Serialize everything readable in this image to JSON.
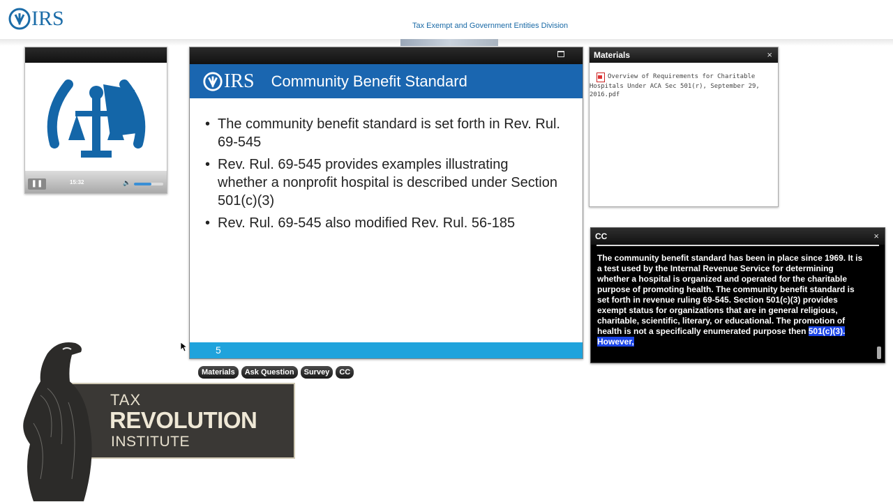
{
  "header": {
    "logo_text": "IRS",
    "division": "Tax Exempt and Government Entities Division"
  },
  "video": {
    "timecode": "15:32",
    "volume_fraction": 0.6
  },
  "slide": {
    "logo_text": "IRS",
    "title": "Community Benefit Standard",
    "bullets": [
      "The community benefit standard is set forth in Rev. Rul. 69-545",
      "Rev. Rul. 69-545 provides examples illustrating whether a nonprofit hospital is described under Section 501(c)(3)",
      "Rev. Rul. 69-545 also modified Rev. Rul. 56-185"
    ],
    "page_number": "5"
  },
  "tabs": [
    "Materials",
    "Ask Question",
    "Survey",
    "CC"
  ],
  "materials": {
    "title": "Materials",
    "close": "×",
    "items": [
      "Overview of Requirements for Charitable Hospitals Under ACA Sec 501(r), September 29, 2016.pdf"
    ]
  },
  "cc": {
    "title": "CC",
    "close": "×",
    "text": "The community benefit standard has been in place since 1969. It is a test used by the Internal Revenue Service for determining whether a hospital is organized and operated for the charitable purpose of promoting health. The community benefit standard is set forth in revenue ruling 69-545. Section 501(c)(3) provides exempt status for organizations that are in general religious, charitable, scientific, literary, or educational. The promotion of health is not a specifically enumerated purpose then ",
    "highlight": "501(c)(3). However,"
  },
  "branding": {
    "line1": "TAX",
    "line2": "REVOLUTION",
    "line3": "INSTITUTE"
  },
  "colors": {
    "irs_blue": "#1b6ca8",
    "slide_header": "#1a66b0",
    "slide_footer": "#1fa3dc",
    "cc_highlight": "#1c46e8"
  }
}
